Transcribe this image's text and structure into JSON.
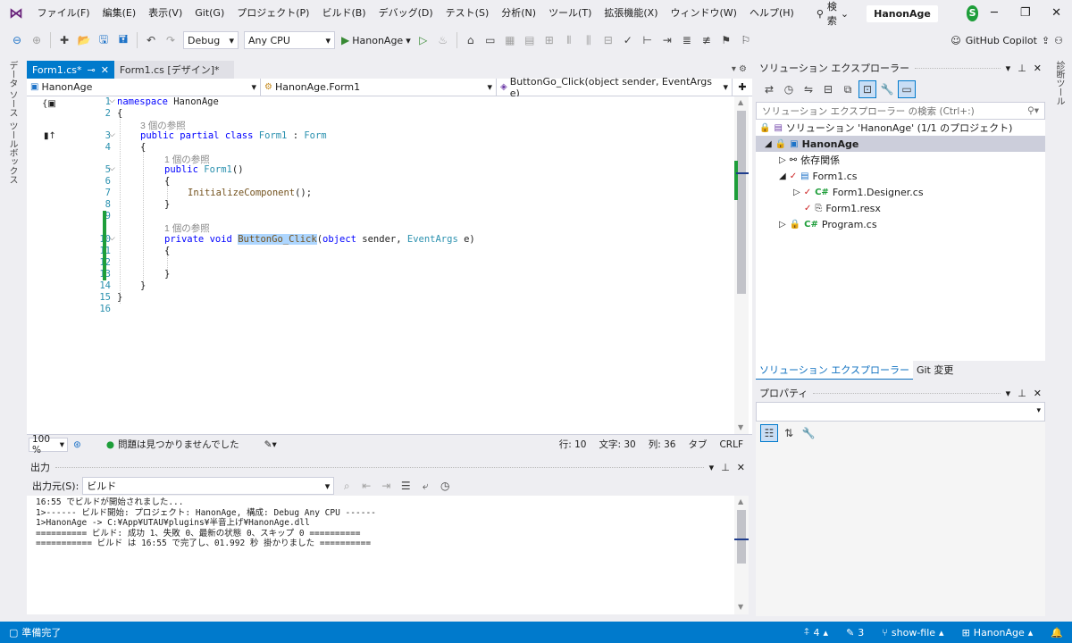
{
  "menubar": {
    "items": [
      "ファイル(F)",
      "編集(E)",
      "表示(V)",
      "Git(G)",
      "プロジェクト(P)",
      "ビルド(B)",
      "デバッグ(D)",
      "テスト(S)",
      "分析(N)",
      "ツール(T)",
      "拡張機能(X)",
      "ウィンドウ(W)",
      "ヘルプ(H)"
    ],
    "search_label": "検索",
    "solution_name": "HanonAge",
    "avatar_letter": "S"
  },
  "toolbar": {
    "config": "Debug",
    "platform": "Any CPU",
    "run_target": "HanonAge",
    "copilot": "GitHub Copilot"
  },
  "left_tabs": [
    "データ ソース",
    "ツールボックス"
  ],
  "right_tabs": [
    "診断ツール"
  ],
  "editor": {
    "tabs": [
      {
        "label": "Form1.cs*"
      },
      {
        "label": "Form1.cs [デザイン]*"
      }
    ],
    "nav": {
      "project": "HanonAge",
      "class": "HanonAge.Form1",
      "member": "ButtonGo_Click(object sender, EventArgs e)"
    },
    "line_numbers": [
      "1",
      "2",
      "3",
      "4",
      "5",
      "6",
      "7",
      "8",
      "9",
      "10",
      "11",
      "12",
      "13",
      "14",
      "15",
      "16"
    ],
    "refs": {
      "class": "3 個の参照",
      "ctor": "1 個の参照",
      "method": "1 個の参照"
    },
    "code": {
      "l1_kw": "namespace",
      "l1_rest": " HanonAge",
      "brace_open": "{",
      "brace_close": "}",
      "l3_kw": "public partial class ",
      "l3_type": "Form1",
      "l3_colon": " : ",
      "l3_base": "Form",
      "l5_kw": "public ",
      "l5_name": "Form1",
      "l5_par": "()",
      "l7_call": "InitializeComponent",
      "l7_rest": "();",
      "l10_kw": "private void ",
      "l10_name": "ButtonGo_Click",
      "l10_p1": "(",
      "l10_kw2": "object",
      "l10_p2": " sender, ",
      "l10_type": "EventArgs",
      "l10_p3": " e)"
    },
    "status": {
      "zoom": "100 %",
      "issues": "問題は見つかりませんでした",
      "line": "行: 10",
      "char": "文字: 30",
      "col": "列: 36",
      "tab": "タブ",
      "eol": "CRLF"
    }
  },
  "output": {
    "title": "出力",
    "source_label": "出力元(S):",
    "source_value": "ビルド",
    "lines": [
      "16:55 でビルドが開始されました...",
      "1>------ ビルド開始: プロジェクト: HanonAge, 構成: Debug Any CPU ------",
      "1>HanonAge -> C:¥App¥UTAU¥plugins¥半音上げ¥HanonAge.dll",
      "========== ビルド: 成功 1、失敗 0、最新の状態 0、スキップ 0 ==========",
      "=========== ビルド は 16:55 で完了し、01.992 秒 掛かりました =========="
    ]
  },
  "solution_explorer": {
    "title": "ソリューション エクスプローラー",
    "search_placeholder": "ソリューション エクスプローラー の検索 (Ctrl+:)",
    "solution": "ソリューション 'HanonAge' (1/1 のプロジェクト)",
    "project": "HanonAge",
    "deps": "依存関係",
    "form_cs": "Form1.cs",
    "designer": "Form1.Designer.cs",
    "resx": "Form1.resx",
    "program": "Program.cs",
    "tabs": [
      "ソリューション エクスプローラー",
      "Git 変更"
    ]
  },
  "properties": {
    "title": "プロパティ"
  },
  "statusbar": {
    "ready": "準備完了",
    "up_count": "4",
    "edit_count": "3",
    "branch": "show-file",
    "repo": "HanonAge"
  },
  "colors": {
    "accent": "#007acc",
    "keyword": "#0000ff",
    "type": "#2b91af",
    "change_bar": "#1e9e3a"
  }
}
